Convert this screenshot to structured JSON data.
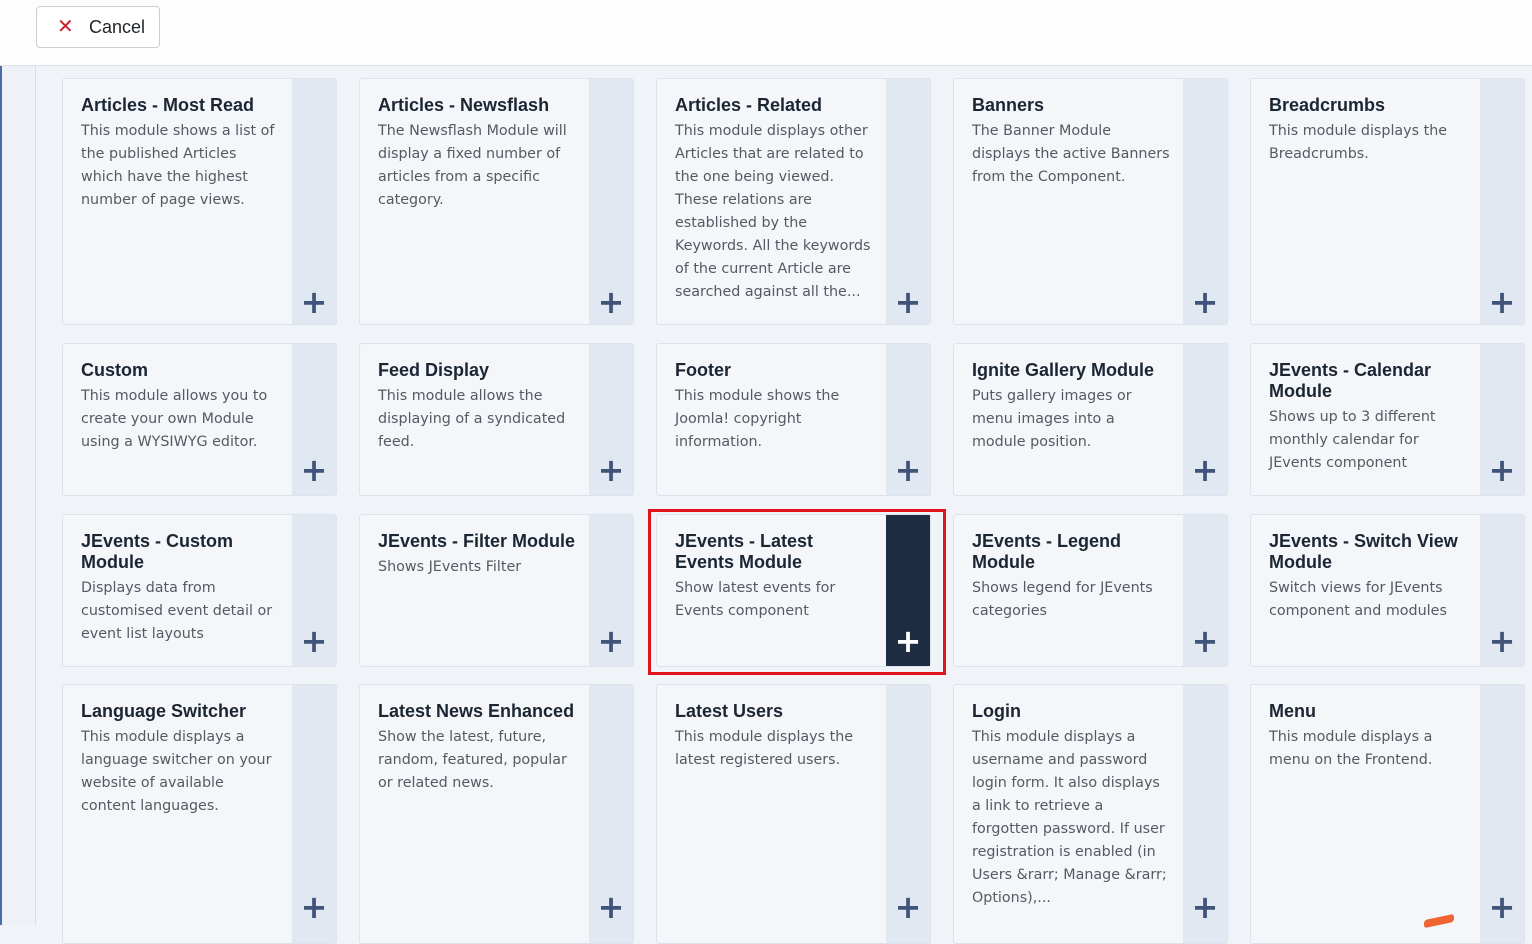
{
  "toolbar": {
    "cancel_label": "Cancel",
    "cancel_icon": "close-icon",
    "cancel_icon_color": "#c8222a"
  },
  "colors": {
    "active_side": "#1f2d42",
    "highlight": "#e0141d"
  },
  "modules": [
    {
      "title": "Articles - Most Read",
      "description": "This module shows a list of the published Articles which have the highest number of page views."
    },
    {
      "title": "Articles - Newsflash",
      "description": "The Newsflash Module will display a fixed number of articles from a specific category."
    },
    {
      "title": "Articles - Related",
      "description": "This module displays other Articles that are related to the one being viewed. These relations are established by the Keywords. All the keywords of the current Article are searched against all the..."
    },
    {
      "title": "Banners",
      "description": "The Banner Module displays the active Banners from the Component."
    },
    {
      "title": "Breadcrumbs",
      "description": "This module displays the Breadcrumbs."
    },
    {
      "title": "Custom",
      "description": "This module allows you to create your own Module using a WYSIWYG editor."
    },
    {
      "title": "Feed Display",
      "description": "This module allows the displaying of a syndicated feed."
    },
    {
      "title": "Footer",
      "description": "This module shows the Joomla! copyright information."
    },
    {
      "title": "Ignite Gallery Module",
      "description": "Puts gallery images or menu images into a module position."
    },
    {
      "title": "JEvents - Calendar Module",
      "description": "Shows up to 3 different monthly calendar for JEvents component"
    },
    {
      "title": "JEvents - Custom Module",
      "description": "Displays data from customised event detail or event list layouts"
    },
    {
      "title": "JEvents - Filter Module",
      "description": "Shows JEvents Filter"
    },
    {
      "title": "JEvents - Latest Events Module",
      "description": "Show latest events for Events component",
      "active": true
    },
    {
      "title": "JEvents - Legend Module",
      "description": "Shows legend for JEvents categories"
    },
    {
      "title": "JEvents - Switch View Module",
      "description": "Switch views for JEvents component and modules"
    },
    {
      "title": "Language Switcher",
      "description": "This module displays a language switcher on your website of available content languages."
    },
    {
      "title": "Latest News Enhanced",
      "description": "Show the latest, future, random, featured, popular or related news."
    },
    {
      "title": "Latest Users",
      "description": "This module displays the latest registered users."
    },
    {
      "title": "Login",
      "description": "This module displays a username and password login form. It also displays a link to retrieve a forgotten password. If user registration is enabled (in Users &rarr; Manage &rarr; Options),..."
    },
    {
      "title": "Menu",
      "description": "This module displays a menu on the Frontend."
    }
  ],
  "add_symbol": "+"
}
